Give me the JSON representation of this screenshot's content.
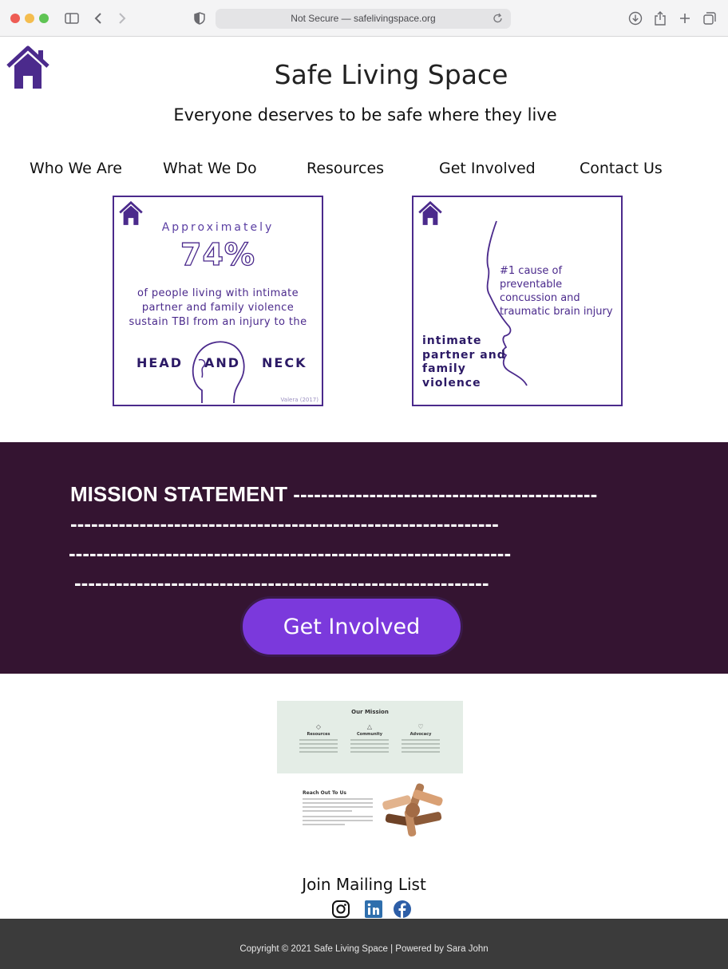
{
  "browser": {
    "address_text": "Not Secure — safelivingspace.org"
  },
  "header": {
    "title": "Safe Living Space",
    "tagline": "Everyone deserves to be safe where they live"
  },
  "nav": {
    "items": [
      {
        "label": "Who We Are"
      },
      {
        "label": "What We Do"
      },
      {
        "label": "Resources"
      },
      {
        "label": "Get Involved"
      },
      {
        "label": "Contact Us"
      }
    ]
  },
  "infographic_1": {
    "approx": "Approximately",
    "percent": "74%",
    "body_lines": [
      "of people living with intimate",
      "partner and family violence",
      "sustain TBI from an injury to the"
    ],
    "head": "HEAD",
    "and": "AND",
    "neck": "NECK",
    "citation": "Valera (2017)"
  },
  "infographic_2": {
    "fact_lines": [
      "#1 cause of preventable",
      "concussion and",
      "traumatic brain injury"
    ],
    "ipv_lines": [
      "intimate",
      "partner and",
      "family",
      "violence"
    ]
  },
  "mission": {
    "title": "MISSION STATEMENT",
    "line1_dashes": "--------------------------------------------",
    "line2": "--------------------------------------------------------------",
    "line3": "----------------------------------------------------------------",
    "line4": "------------------------------------------------------------",
    "cta_label": "Get Involved"
  },
  "preview": {
    "heading": "Our Mission",
    "columns": [
      {
        "title": "Resources",
        "icon": "diamond-icon"
      },
      {
        "title": "Community",
        "icon": "triangle-icon"
      },
      {
        "title": "Advocacy",
        "icon": "heart-icon"
      }
    ],
    "reach_title": "Reach Out To Us"
  },
  "mailing": {
    "label": "Join Mailing List"
  },
  "social": [
    "instagram-icon",
    "linkedin-icon",
    "facebook-icon"
  ],
  "footer": {
    "copyright": "Copyright © 2021 Safe Living Space | Powered by Sara John"
  },
  "colors": {
    "brand_purple": "#4b2a8c",
    "band": "#341431",
    "cta": "#7b39dc",
    "footer": "#3b3b3b"
  }
}
